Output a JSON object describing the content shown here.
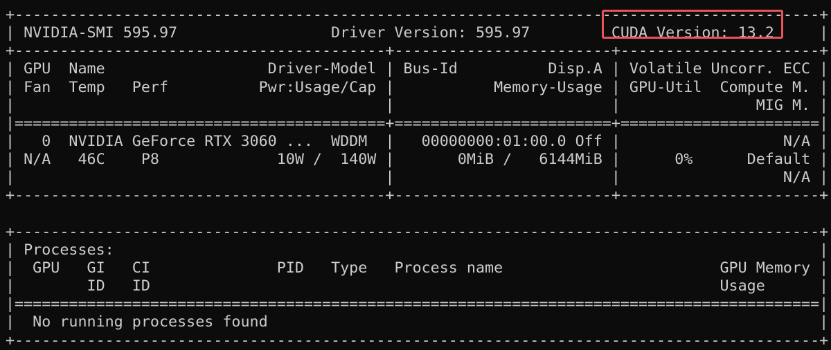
{
  "terminal": {
    "lines": [
      "+-----------------------------------------------------------------------------------------+",
      "| NVIDIA-SMI 595.97                 Driver Version: 595.97         CUDA Version: 13.2     |",
      "+-----------------------------------------+------------------------+----------------------+",
      "| GPU  Name                  Driver-Model | Bus-Id          Disp.A | Volatile Uncorr. ECC |",
      "| Fan  Temp   Perf          Pwr:Usage/Cap |           Memory-Usage | GPU-Util  Compute M. |",
      "|                                         |                        |               MIG M. |",
      "|=========================================+========================+======================|",
      "|   0  NVIDIA GeForce RTX 3060 ...  WDDM  |   00000000:01:00.0 Off |                  N/A |",
      "| N/A   46C    P8             10W /  140W |       0MiB /   6144MiB |      0%      Default |",
      "|                                         |                        |                  N/A |",
      "+-----------------------------------------+------------------------+----------------------+",
      "",
      "+-----------------------------------------------------------------------------------------+",
      "| Processes:                                                                              |",
      "|  GPU   GI   CI              PID   Type   Process name                        GPU Memory |",
      "|        ID   ID                                                               Usage      |",
      "|=========================================================================================|",
      "|  No running processes found                                                             |",
      "+-----------------------------------------------------------------------------------------+"
    ]
  },
  "highlight": {
    "label": "CUDA Version: 13.2",
    "color": "#e8545a"
  }
}
